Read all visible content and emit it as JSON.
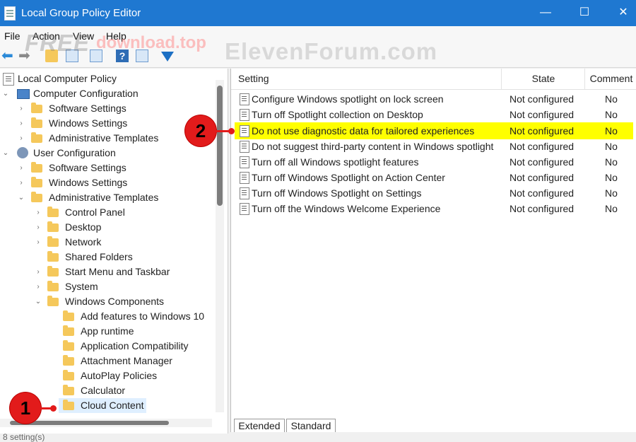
{
  "window": {
    "title": "Local Group Policy Editor",
    "controls": [
      "—",
      "☐",
      "✕"
    ]
  },
  "menu": [
    {
      "label": "File"
    },
    {
      "label": "Action"
    },
    {
      "label": "View"
    },
    {
      "label": "Help"
    }
  ],
  "watermarks": {
    "free": "FREE",
    "download": "download.top",
    "forum": "ElevenForum.com"
  },
  "tree": [
    {
      "label": "Local Computer Policy"
    },
    {
      "label": "Computer Configuration"
    },
    {
      "label": "Software Settings"
    },
    {
      "label": "Windows Settings"
    },
    {
      "label": "Administrative Templates"
    },
    {
      "label": "User Configuration"
    },
    {
      "label": "Software Settings"
    },
    {
      "label": "Windows Settings"
    },
    {
      "label": "Administrative Templates"
    },
    {
      "label": "Control Panel"
    },
    {
      "label": "Desktop"
    },
    {
      "label": "Network"
    },
    {
      "label": "Shared Folders"
    },
    {
      "label": "Start Menu and Taskbar"
    },
    {
      "label": "System"
    },
    {
      "label": "Windows Components"
    },
    {
      "label": "Add features to Windows 10"
    },
    {
      "label": "App runtime"
    },
    {
      "label": "Application Compatibility"
    },
    {
      "label": "Attachment Manager"
    },
    {
      "label": "AutoPlay Policies"
    },
    {
      "label": "Calculator"
    },
    {
      "label": "Cloud Content"
    }
  ],
  "table": {
    "headers": {
      "setting": "Setting",
      "state": "State",
      "comment": "Comment"
    },
    "rows": [
      {
        "setting": "Configure Windows spotlight on lock screen",
        "state": "Not configured",
        "comment": "No"
      },
      {
        "setting": "Turn off Spotlight collection on Desktop",
        "state": "Not configured",
        "comment": "No"
      },
      {
        "setting": "Do not use diagnostic data for tailored experiences",
        "state": "Not configured",
        "comment": "No"
      },
      {
        "setting": "Do not suggest third-party content in Windows spotlight",
        "state": "Not configured",
        "comment": "No"
      },
      {
        "setting": "Turn off all Windows spotlight features",
        "state": "Not configured",
        "comment": "No"
      },
      {
        "setting": "Turn off Windows Spotlight on Action Center",
        "state": "Not configured",
        "comment": "No"
      },
      {
        "setting": "Turn off Windows Spotlight on Settings",
        "state": "Not configured",
        "comment": "No"
      },
      {
        "setting": "Turn off the Windows Welcome Experience",
        "state": "Not configured",
        "comment": "No"
      }
    ]
  },
  "tabs": {
    "extended": "Extended",
    "standard": "Standard"
  },
  "callouts": {
    "one": "1",
    "two": "2"
  },
  "status": {
    "text": "8 setting(s)"
  }
}
